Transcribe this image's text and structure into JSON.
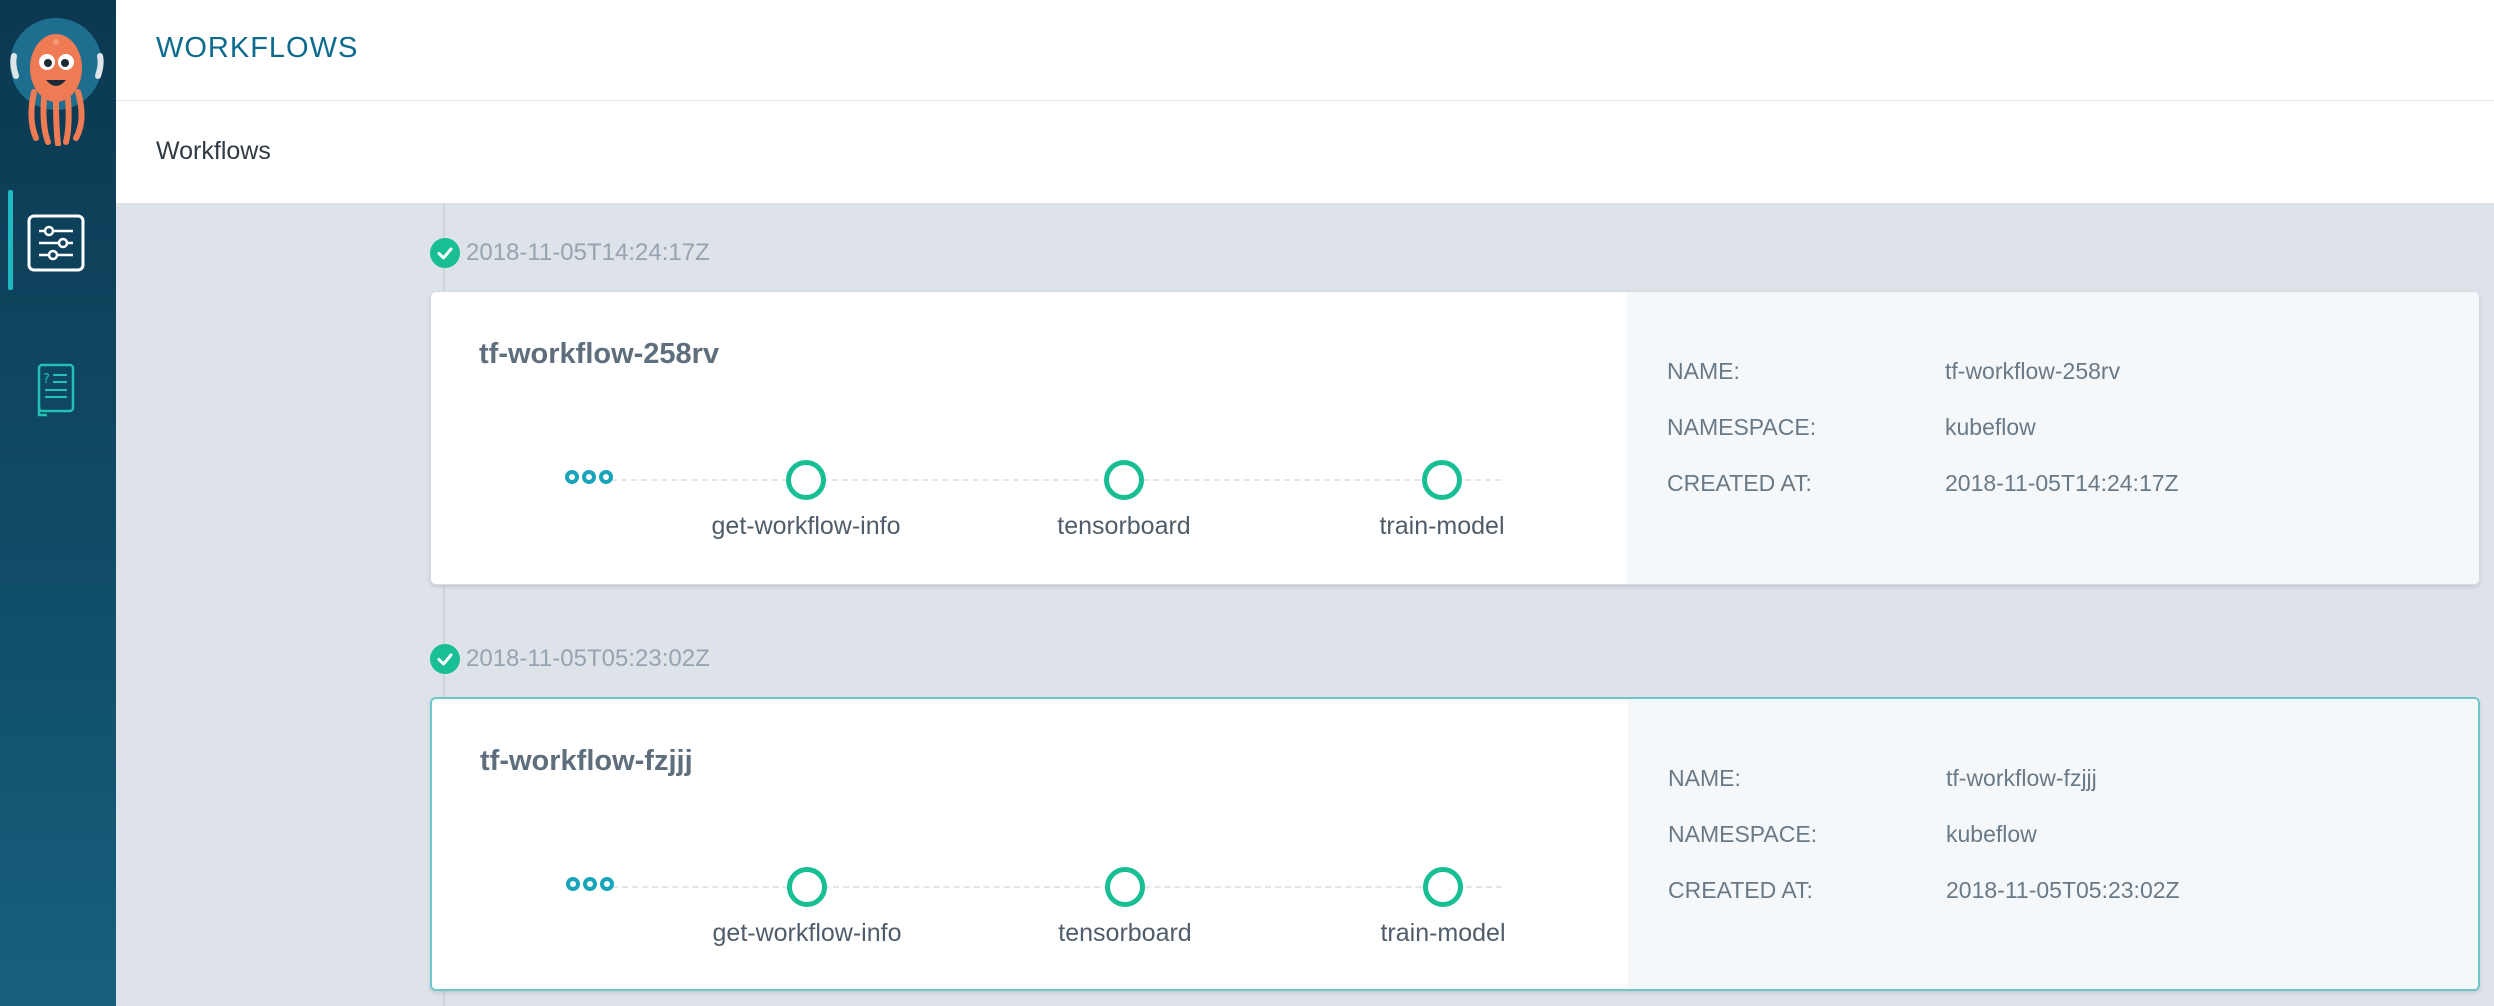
{
  "header": {
    "title": "WORKFLOWS"
  },
  "breadcrumb": {
    "label": "Workflows"
  },
  "workflows": [
    {
      "timestamp": "2018-11-05T14:24:17Z",
      "name": "tf-workflow-258rv",
      "steps": [
        "get-workflow-info",
        "tensorboard",
        "train-model"
      ],
      "details": {
        "name_key": "NAME:",
        "name_value": "tf-workflow-258rv",
        "namespace_key": "NAMESPACE:",
        "namespace_value": "kubeflow",
        "created_key": "CREATED AT:",
        "created_value": "2018-11-05T14:24:17Z"
      }
    },
    {
      "timestamp": "2018-11-05T05:23:02Z",
      "name": "tf-workflow-fzjjj",
      "steps": [
        "get-workflow-info",
        "tensorboard",
        "train-model"
      ],
      "details": {
        "name_key": "NAME:",
        "name_value": "tf-workflow-fzjjj",
        "namespace_key": "NAMESPACE:",
        "namespace_value": "kubeflow",
        "created_key": "CREATED AT:",
        "created_value": "2018-11-05T05:23:02Z"
      }
    }
  ],
  "colors": {
    "accent": "#18be94",
    "brand": "#0c6b8d",
    "sidebar": "#0b3850"
  },
  "icons": {
    "logo": "argo-octopus-logo",
    "nav1": "sliders-icon",
    "nav2": "help-book-icon"
  }
}
